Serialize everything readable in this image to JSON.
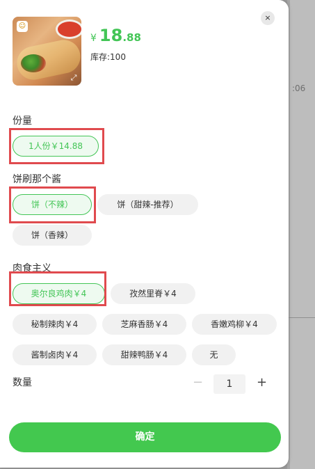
{
  "background": {
    "time_fragment": ":06"
  },
  "product": {
    "logo_icon": "brand-logo-icon",
    "price_symbol": "¥",
    "price_int": "18",
    "price_dec": ".88",
    "stock": "库存:100",
    "accent_color": "#43c556",
    "highlight_color": "#e04a4e"
  },
  "close_icon": "×",
  "groups": {
    "portion": {
      "title": "份量",
      "options": [
        "1人份￥14.88"
      ]
    },
    "sauce": {
      "title": "饼刷那个酱",
      "options": [
        "饼（不辣）",
        "饼（甜辣-推荐）",
        "饼（香辣）"
      ]
    },
    "meat": {
      "title": "肉食主义",
      "options": [
        "奥尔良鸡肉￥4",
        "孜然里脊￥4",
        "秘制辣肉￥4",
        "芝麻香肠￥4",
        "香嫩鸡柳￥4",
        "酱制卤肉￥4",
        "甜辣鸭肠￥4",
        "无"
      ]
    }
  },
  "quantity": {
    "label": "数量",
    "minus": "−",
    "value": "1",
    "plus": "+"
  },
  "confirm_label": "确定"
}
